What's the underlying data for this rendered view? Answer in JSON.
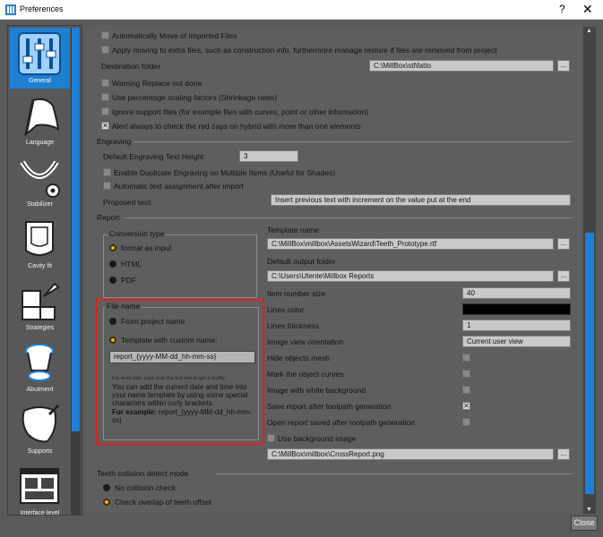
{
  "window": {
    "title": "Preferences",
    "help": "?",
    "close": "✕"
  },
  "sidebar": {
    "items": [
      {
        "label": "General",
        "icon": "sliders-icon"
      },
      {
        "label": "Language",
        "icon": "flag-icon"
      },
      {
        "label": "Stabilizer",
        "icon": "stabilizer-icon"
      },
      {
        "label": "Cavity fit",
        "icon": "cavity-icon"
      },
      {
        "label": "Strategies",
        "icon": "strategies-icon"
      },
      {
        "label": "Abutment",
        "icon": "abutment-icon"
      },
      {
        "label": "Supports",
        "icon": "supports-icon"
      },
      {
        "label": "Interface level",
        "icon": "interface-icon"
      }
    ]
  },
  "import": {
    "auto_move": "Automatically Move of Imported Files",
    "apply_moving": "Apply moving to extra files, such as construction info, furthermore manage restore if files are removed from project",
    "dest_label": "Destination folder",
    "dest_value": "C:\\MillBox\\stl\\fatto",
    "warning_replace": "Warning Replace not done",
    "percentage_scaling": "Use percentage scaling factors (Shrinkage rates)",
    "ignore_support": "Ignore support files (for example files with curves, point or other information)",
    "alert_red_caps": "Alert always to check the red caps on hybrid with more than one elements"
  },
  "engraving": {
    "section": "Engraving",
    "height_label": "Default Engraving Text Height",
    "height_value": "3",
    "dup_engraving": "Enable Duplicate Engraving on Multiple Items (Useful for Shades)",
    "auto_text": "Automatic text assignment after import",
    "proposed_label": "Proposed text:",
    "proposed_value": "Insert previous text with increment on the value put at the end"
  },
  "report": {
    "section": "Report",
    "conversion_legend": "Conversion type",
    "conv_options": [
      "format as input",
      "HTML",
      "PDF"
    ],
    "template_label": "Template name",
    "template_value": "C:\\MillBox\\millbox\\AssetsWizard\\Teeth_Prototype.rtf",
    "output_label": "Default output folder",
    "output_value": "C:\\Users\\Utente\\Millbox Reports",
    "filename_legend": "File name",
    "fn_from_project": "From project name",
    "fn_template": "Template with custom name:",
    "fn_value": "report_{yyyy-MM-dd_hh-mm-ss}",
    "fn_tip": "For more info, pass over the text box to get a tooltip.",
    "fn_help": "You can add the current date and time into your name template by using some special characters within curly brackets.",
    "fn_example_label": "For example:",
    "fn_example_value": "report_{yyyy-MM-dd_hh-mm-ss}",
    "item_size_label": "Item number size",
    "item_size_value": "40",
    "lines_color_label": "Lines color",
    "lines_color_value": "#000000",
    "lines_thick_label": "Lines thickness",
    "lines_thick_value": "1",
    "orientation_label": "Image view orientation",
    "orientation_value": "Current user view",
    "hide_mesh": "Hide objects mesh",
    "mark_curves": "Mark the object curves",
    "white_bg": "Image with white background",
    "save_after": "Save report after toolpath generation",
    "open_after": "Open report saved after toolpath generation",
    "use_bg": "Use background image",
    "bg_value": "C:\\MillBox\\millbox\\CrossReport.png"
  },
  "collision": {
    "section": "Teeth collision detect mode",
    "no_check": "No collision check",
    "check_overlap": "Check overlap of teeth offset"
  },
  "buttons": {
    "browse": "...",
    "close": "Close"
  },
  "colors": {
    "accent": "#1f7fd0",
    "highlight_border": "#e02020",
    "radio_on": "#f0b020"
  }
}
